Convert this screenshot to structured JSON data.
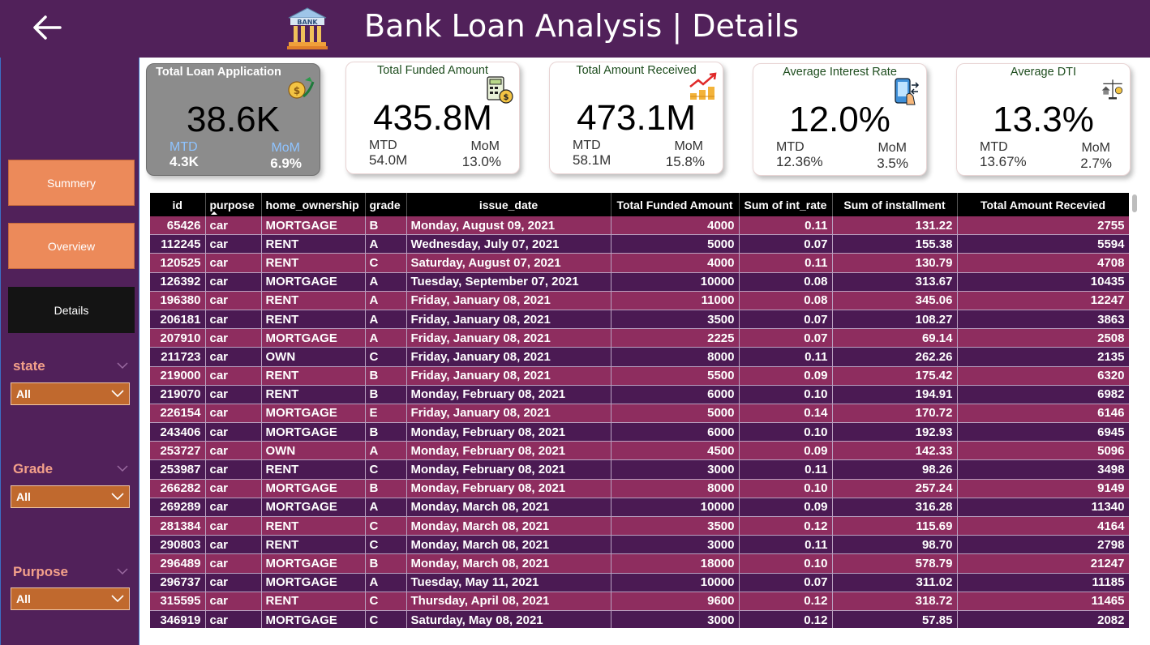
{
  "header": {
    "title": "Bank Loan Analysis | Details",
    "bank_icon_text": "BANK"
  },
  "nav": {
    "summary": "Summery",
    "overview": "Overview",
    "details": "Details"
  },
  "slicers": [
    {
      "label": "state",
      "value": "All"
    },
    {
      "label": "Grade",
      "value": "All"
    },
    {
      "label": "Purpose",
      "value": "All"
    }
  ],
  "cards": [
    {
      "title": "Total Loan Application",
      "value": "38.6K",
      "mtd_label": "MTD",
      "mtd_value": "4.3K",
      "mom_label": "MoM",
      "mom_value": "6.9%",
      "icon": "money-hand-icon"
    },
    {
      "title": "Total Funded Amount",
      "value": "435.8M",
      "mtd_label": "MTD",
      "mtd_value": "54.0M",
      "mom_label": "MoM",
      "mom_value": "13.0%",
      "icon": "calculator-icon"
    },
    {
      "title": "Total Amount Received",
      "value": "473.1M",
      "mtd_label": "MTD",
      "mtd_value": "58.1M",
      "mom_label": "MoM",
      "mom_value": "15.8%",
      "icon": "growth-coins-icon"
    },
    {
      "title": "Average Interest Rate",
      "value": "12.0%",
      "mtd_label": "MTD",
      "mtd_value": "12.36%",
      "mom_label": "MoM",
      "mom_value": "3.5%",
      "icon": "phone-payment-icon"
    },
    {
      "title": "Average DTI",
      "value": "13.3%",
      "mtd_label": "MTD",
      "mtd_value": "13.67%",
      "mom_label": "MoM",
      "mom_value": "2.7%",
      "icon": "home-scale-icon"
    }
  ],
  "table": {
    "columns": [
      "id",
      "purpose",
      "home_ownership",
      "grade",
      "issue_date",
      "Total Funded Amount",
      "Sum of int_rate",
      "Sum of installment",
      "Total Amount Recevied"
    ],
    "rows": [
      [
        "65426",
        "car",
        "MORTGAGE",
        "B",
        "Monday, August 09, 2021",
        "4000",
        "0.11",
        "131.22",
        "2755"
      ],
      [
        "112245",
        "car",
        "RENT",
        "A",
        "Wednesday, July 07, 2021",
        "5000",
        "0.07",
        "155.38",
        "5594"
      ],
      [
        "120525",
        "car",
        "RENT",
        "C",
        "Saturday, August 07, 2021",
        "4000",
        "0.11",
        "130.79",
        "4708"
      ],
      [
        "126392",
        "car",
        "MORTGAGE",
        "A",
        "Tuesday, September 07, 2021",
        "10000",
        "0.08",
        "313.67",
        "10435"
      ],
      [
        "196380",
        "car",
        "RENT",
        "A",
        "Friday, January 08, 2021",
        "11000",
        "0.08",
        "345.06",
        "12247"
      ],
      [
        "206181",
        "car",
        "RENT",
        "A",
        "Friday, January 08, 2021",
        "3500",
        "0.07",
        "108.27",
        "3863"
      ],
      [
        "207910",
        "car",
        "MORTGAGE",
        "A",
        "Friday, January 08, 2021",
        "2225",
        "0.07",
        "69.14",
        "2508"
      ],
      [
        "211723",
        "car",
        "OWN",
        "C",
        "Friday, January 08, 2021",
        "8000",
        "0.11",
        "262.26",
        "2135"
      ],
      [
        "219000",
        "car",
        "RENT",
        "B",
        "Friday, January 08, 2021",
        "5500",
        "0.09",
        "175.42",
        "6320"
      ],
      [
        "219070",
        "car",
        "RENT",
        "B",
        "Monday, February 08, 2021",
        "6000",
        "0.10",
        "194.91",
        "6982"
      ],
      [
        "226154",
        "car",
        "MORTGAGE",
        "E",
        "Friday, January 08, 2021",
        "5000",
        "0.14",
        "170.72",
        "6146"
      ],
      [
        "243406",
        "car",
        "MORTGAGE",
        "B",
        "Monday, February 08, 2021",
        "6000",
        "0.10",
        "192.93",
        "6945"
      ],
      [
        "253727",
        "car",
        "OWN",
        "A",
        "Monday, February 08, 2021",
        "4500",
        "0.09",
        "142.33",
        "5096"
      ],
      [
        "253987",
        "car",
        "RENT",
        "C",
        "Monday, February 08, 2021",
        "3000",
        "0.11",
        "98.26",
        "3498"
      ],
      [
        "266282",
        "car",
        "MORTGAGE",
        "B",
        "Monday, February 08, 2021",
        "8000",
        "0.10",
        "257.24",
        "9149"
      ],
      [
        "269289",
        "car",
        "MORTGAGE",
        "A",
        "Monday, March 08, 2021",
        "10000",
        "0.09",
        "316.28",
        "11340"
      ],
      [
        "281384",
        "car",
        "RENT",
        "C",
        "Monday, March 08, 2021",
        "3500",
        "0.12",
        "115.69",
        "4164"
      ],
      [
        "290803",
        "car",
        "RENT",
        "C",
        "Monday, March 08, 2021",
        "3000",
        "0.11",
        "98.70",
        "2798"
      ],
      [
        "296489",
        "car",
        "MORTGAGE",
        "B",
        "Monday, March 08, 2021",
        "18000",
        "0.10",
        "578.79",
        "21247"
      ],
      [
        "296737",
        "car",
        "MORTGAGE",
        "A",
        "Tuesday, May 11, 2021",
        "10000",
        "0.07",
        "311.02",
        "11185"
      ],
      [
        "315595",
        "car",
        "RENT",
        "C",
        "Thursday, April 08, 2021",
        "9600",
        "0.12",
        "318.72",
        "11465"
      ],
      [
        "346919",
        "car",
        "MORTGAGE",
        "C",
        "Saturday, May 08, 2021",
        "3000",
        "0.12",
        "57.85",
        "2082"
      ]
    ]
  }
}
